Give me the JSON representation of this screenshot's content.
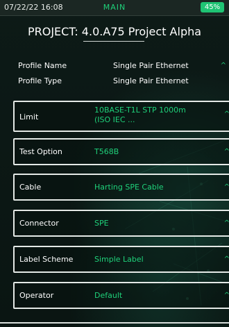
{
  "status_bar": {
    "datetime": "07/22/22 16:08",
    "screen_name": "MAIN",
    "battery": "45%"
  },
  "project": {
    "label": "PROJECT: 4.0.A75 Project Alpha"
  },
  "profile": [
    {
      "label": "Profile Name",
      "value": "Single Pair Ethernet"
    },
    {
      "label": "Profile Type",
      "value": "Single Pair Ethernet"
    }
  ],
  "settings": [
    {
      "label": "Limit",
      "value_line1": "10BASE-T1L STP 1000m",
      "value_line2": "(ISO IEC ..."
    },
    {
      "label": "Test Option",
      "value": "T568B"
    },
    {
      "label": "Cable",
      "value": "Harting SPE Cable"
    },
    {
      "label": "Connector",
      "value": "SPE"
    },
    {
      "label": "Label Scheme",
      "value": "Simple Label"
    },
    {
      "label": "Operator",
      "value": "Default"
    }
  ],
  "icons": {
    "chevron": "chevron-up-icon"
  },
  "colors": {
    "accent_green": "#1fd17a",
    "battery_green": "#1fc474",
    "background": "#0a1613",
    "box_border": "#e4e9e6"
  }
}
